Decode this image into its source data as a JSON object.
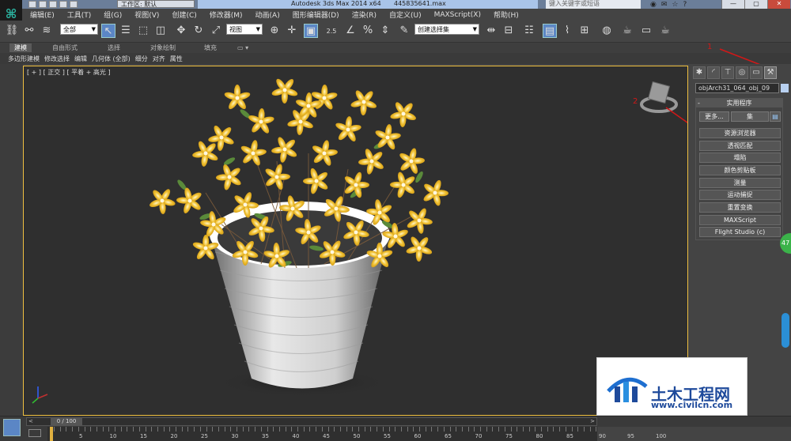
{
  "titlebar": {
    "workspace": "工作区: 默认",
    "app_title": "Autodesk 3ds Max  2014 x64",
    "file_name": "445835641.max",
    "search_placeholder": "键入关键字或短语"
  },
  "menu": [
    "编辑(E)",
    "工具(T)",
    "组(G)",
    "视图(V)",
    "创建(C)",
    "修改器(M)",
    "动画(A)",
    "图形编辑器(D)",
    "渲染(R)",
    "自定义(U)",
    "MAXScript(X)",
    "帮助(H)"
  ],
  "toolbar": {
    "selection_filter": "全部",
    "reference_coord": "视图",
    "named_selection": "创建选择集",
    "snap_value": "2.5"
  },
  "ribbon": {
    "tabs": [
      "建模",
      "自由形式",
      "选择",
      "对象绘制",
      "填充"
    ],
    "subtabs": [
      "多边形建模",
      "修改选择",
      "编辑",
      "几何体 (全部)",
      "细分",
      "对齐",
      "属性"
    ]
  },
  "viewport": {
    "label": "[ + ] [ 正交 ] [ 平着 + 高光 ]",
    "annotation_1": "1",
    "annotation_2": "2"
  },
  "command_panel": {
    "object_name": "objArch31_064_obj_09",
    "rollout_title": "实用程序",
    "more_label": "更多...",
    "sets_label": "集",
    "buttons": [
      "资源浏览器",
      "透视匹配",
      "塌陷",
      "颜色剪贴板",
      "测量",
      "运动捕捉",
      "重置变换",
      "MAXScript",
      "Flight Studio (c)"
    ]
  },
  "badge": "47",
  "watermark": {
    "name_cn": "土木工程网",
    "url": "www.civilcn.com"
  },
  "timeline": {
    "frame_readout": "0 / 100",
    "ticks": [
      "5",
      "10",
      "15",
      "20",
      "25",
      "30",
      "35",
      "40",
      "45",
      "50",
      "55",
      "60",
      "65",
      "70",
      "75",
      "80",
      "85",
      "90"
    ],
    "right_ticks": [
      "90",
      "95",
      "100"
    ]
  }
}
